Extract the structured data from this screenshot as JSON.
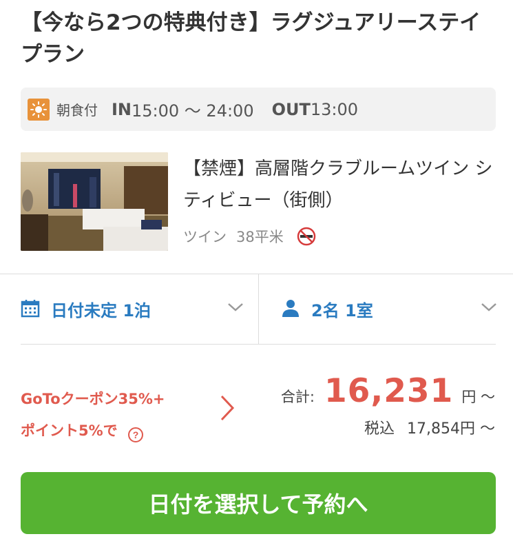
{
  "plan": {
    "title": "【今なら2つの特典付き】ラグジュアリーステイプラン"
  },
  "info_bar": {
    "meal_icon": "sun-icon",
    "meal_label": "朝食付",
    "checkin_label": "IN",
    "checkin_time": "15:00 〜 24:00",
    "checkout_label": "OUT",
    "checkout_time": "13:00"
  },
  "room": {
    "name": "【禁煙】高層階クラブルームツイン シティビュー（街側）",
    "type": "ツイン",
    "area": "38平米",
    "smoking_icon": "no-smoking-icon"
  },
  "selectors": {
    "date_label": "日付未定 1泊",
    "guests_label": "2名 1室"
  },
  "coupon": {
    "line1": "GoToクーポン35%+",
    "line2": "ポイント5%で"
  },
  "price": {
    "total_label": "合計:",
    "total_value": "16,231",
    "total_unit": "円 〜",
    "tax_label": "税込",
    "tax_value": "17,854円 〜"
  },
  "cta": {
    "label": "日付を選択して予約へ"
  },
  "colors": {
    "accent_blue": "#2a7bc0",
    "price_red": "#e05a4e",
    "button_green": "#56b332",
    "meal_orange": "#e8923a"
  }
}
